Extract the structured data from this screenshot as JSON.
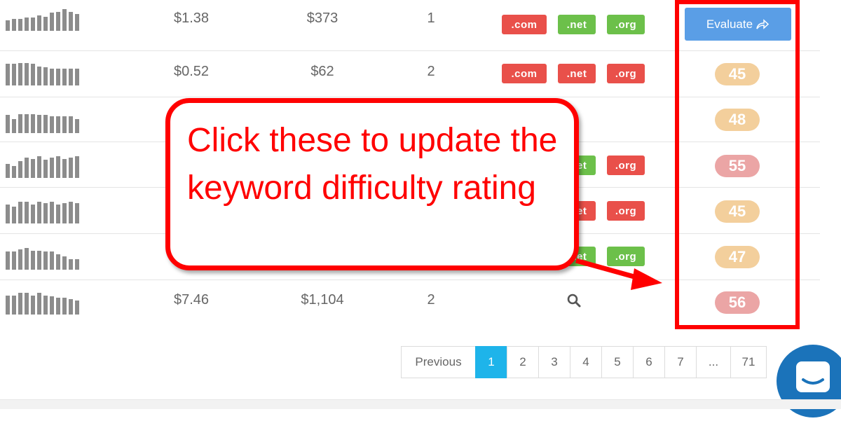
{
  "rows": [
    {
      "cpc": "$1.38",
      "volume": "$373",
      "count": "1",
      "tlds": [
        {
          "label": ".com",
          "color": "red"
        },
        {
          "label": ".net",
          "color": "green"
        },
        {
          "label": ".org",
          "color": "green"
        }
      ],
      "trend": [
        0.45,
        0.5,
        0.5,
        0.55,
        0.55,
        0.65,
        0.6,
        0.75,
        0.8,
        0.9,
        0.8,
        0.7
      ]
    },
    {
      "cpc": "$0.52",
      "volume": "$62",
      "count": "2",
      "tlds": [
        {
          "label": ".com",
          "color": "red"
        },
        {
          "label": ".net",
          "color": "red"
        },
        {
          "label": ".org",
          "color": "red"
        }
      ],
      "difficulty": "45",
      "level": "orange",
      "trend": [
        0.9,
        0.9,
        0.95,
        0.95,
        0.9,
        0.8,
        0.75,
        0.7,
        0.7,
        0.7,
        0.7,
        0.7
      ]
    },
    {
      "difficulty": "48",
      "level": "orange",
      "trend": [
        0.75,
        0.6,
        0.8,
        0.8,
        0.8,
        0.75,
        0.75,
        0.7,
        0.7,
        0.7,
        0.7,
        0.6
      ]
    },
    {
      "tlds": [
        {
          "label": ".net",
          "color": "green"
        },
        {
          "label": ".org",
          "color": "red"
        }
      ],
      "difficulty": "55",
      "level": "pink",
      "trend": [
        0.6,
        0.5,
        0.7,
        0.85,
        0.8,
        0.9,
        0.75,
        0.85,
        0.9,
        0.8,
        0.85,
        0.9
      ]
    },
    {
      "tlds": [
        {
          "label": ".net",
          "color": "red"
        },
        {
          "label": ".org",
          "color": "red"
        }
      ],
      "difficulty": "45",
      "level": "orange",
      "trend": [
        0.8,
        0.7,
        0.9,
        0.9,
        0.8,
        0.9,
        0.85,
        0.9,
        0.8,
        0.85,
        0.9,
        0.85
      ]
    },
    {
      "tlds": [
        {
          "label": ".net",
          "color": "green"
        },
        {
          "label": ".org",
          "color": "green"
        }
      ],
      "difficulty": "47",
      "level": "orange",
      "trend": [
        0.75,
        0.75,
        0.85,
        0.9,
        0.8,
        0.8,
        0.75,
        0.75,
        0.65,
        0.55,
        0.45,
        0.45
      ]
    },
    {
      "cpc": "$7.46",
      "volume": "$1,104",
      "count": "2",
      "difficulty": "56",
      "level": "pink",
      "trend": [
        0.8,
        0.8,
        0.9,
        0.9,
        0.8,
        0.9,
        0.8,
        0.75,
        0.7,
        0.7,
        0.65,
        0.6
      ]
    }
  ],
  "evaluate_label": "Evaluate",
  "callout_text": "Click these to update the keyword difficulty rating",
  "pagination": {
    "previous": "Previous",
    "pages": [
      "1",
      "2",
      "3",
      "4",
      "5",
      "6",
      "7",
      "...",
      "71"
    ],
    "active": "1"
  },
  "colors": {
    "accent": "#1eb4ea",
    "evaluate": "#5a9ee6",
    "annotation": "#ff0000"
  }
}
